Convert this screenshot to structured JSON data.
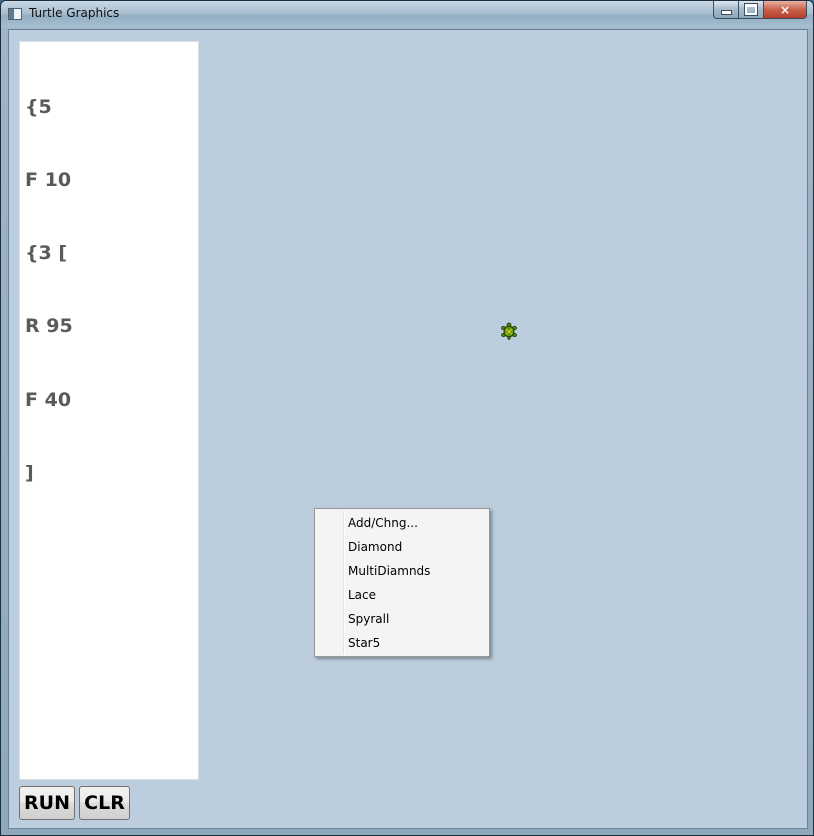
{
  "window": {
    "title": "Turtle Graphics",
    "close_label": "×"
  },
  "editor": {
    "lines": [
      "{5",
      "F 10",
      "{3 [",
      "R 95",
      "F 40",
      "]"
    ]
  },
  "buttons": {
    "run_label": "RUN",
    "clear_label": "CLR"
  },
  "canvas": {
    "turtle_icon": "turtle-icon",
    "turtle_color": "#4f8a10"
  },
  "context_menu": {
    "items": [
      "Add/Chng...",
      "Diamond",
      "MultiDiamnds",
      "Lace",
      "Spyrall",
      "Star5"
    ]
  },
  "colors": {
    "canvas_background": "#bccddd",
    "editor_text": "#5a5a5a",
    "close_button": "#c9604a"
  }
}
